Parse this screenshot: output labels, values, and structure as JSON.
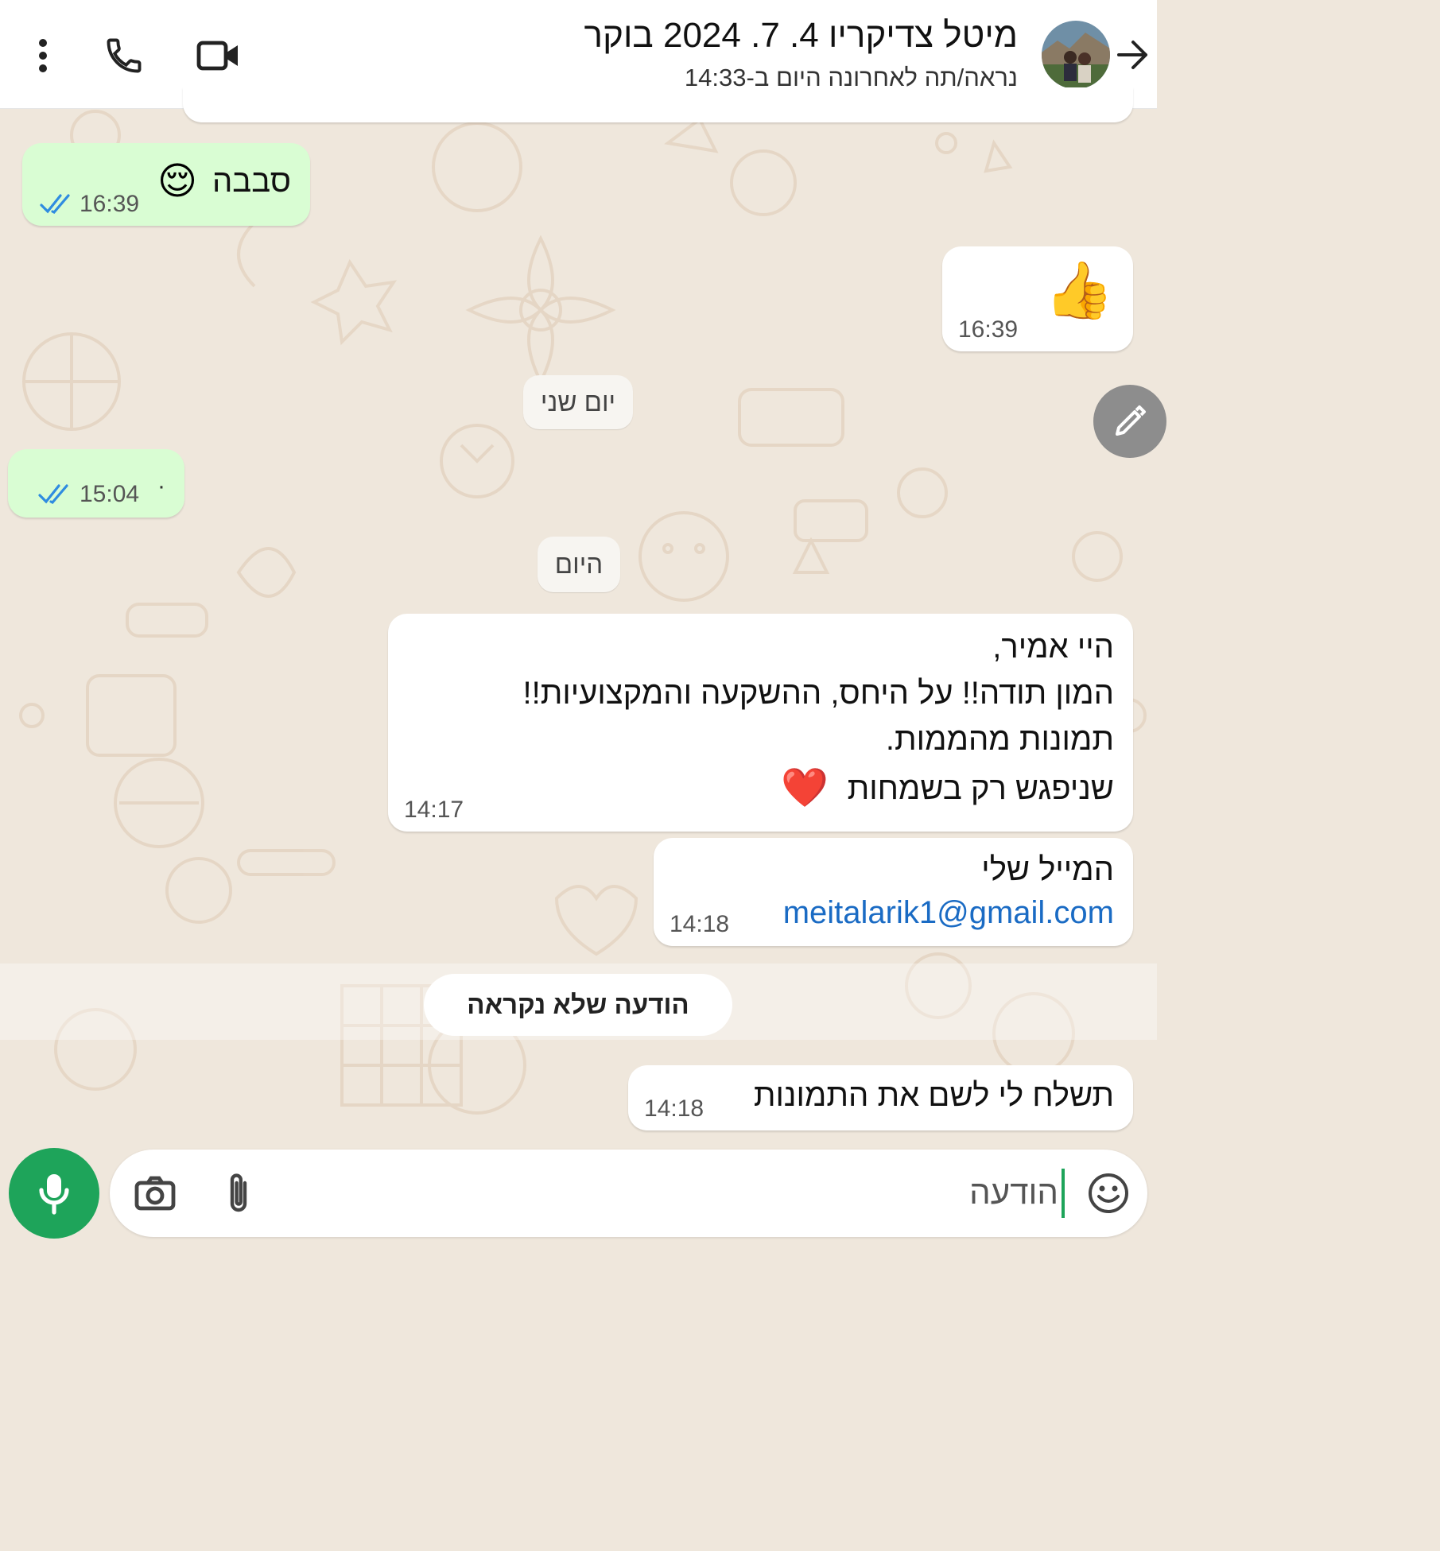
{
  "header": {
    "title": "מיטל צדיקריו 4. 7. 2024 בוקר",
    "subtitle": "נראה/תה לאחרונה היום ב-14:33"
  },
  "messages": {
    "m1": {
      "text": "סבבה",
      "emoji": "😌",
      "time": "16:39"
    },
    "m2": {
      "emoji": "👍",
      "time": "16:39"
    },
    "m3": {
      "dot": "·",
      "time": "15:04"
    },
    "m4": {
      "lines": [
        "היי אמיר,",
        "המון תודה!! על היחס, ההשקעה והמקצועיות!!",
        "תמונות מהממות.",
        "שניפגש רק בשמחות"
      ],
      "emoji": "❤️",
      "time": "14:17"
    },
    "m5": {
      "line1": "המייל שלי",
      "email": "meitalarik1@gmail.com",
      "time": "14:18"
    },
    "m6": {
      "text": "תשלח לי לשם את התמונות",
      "time": "14:18"
    }
  },
  "separators": {
    "yesterday": "יום שני",
    "today": "היום"
  },
  "unread_banner": "הודעה שלא נקראה",
  "input": {
    "placeholder": "הודעה"
  },
  "colors": {
    "outgoing": "#d9fdd3",
    "incoming": "#ffffff",
    "accent": "#1ea45a",
    "ticks": "#2f8ce0",
    "link": "#1a6bc4"
  }
}
